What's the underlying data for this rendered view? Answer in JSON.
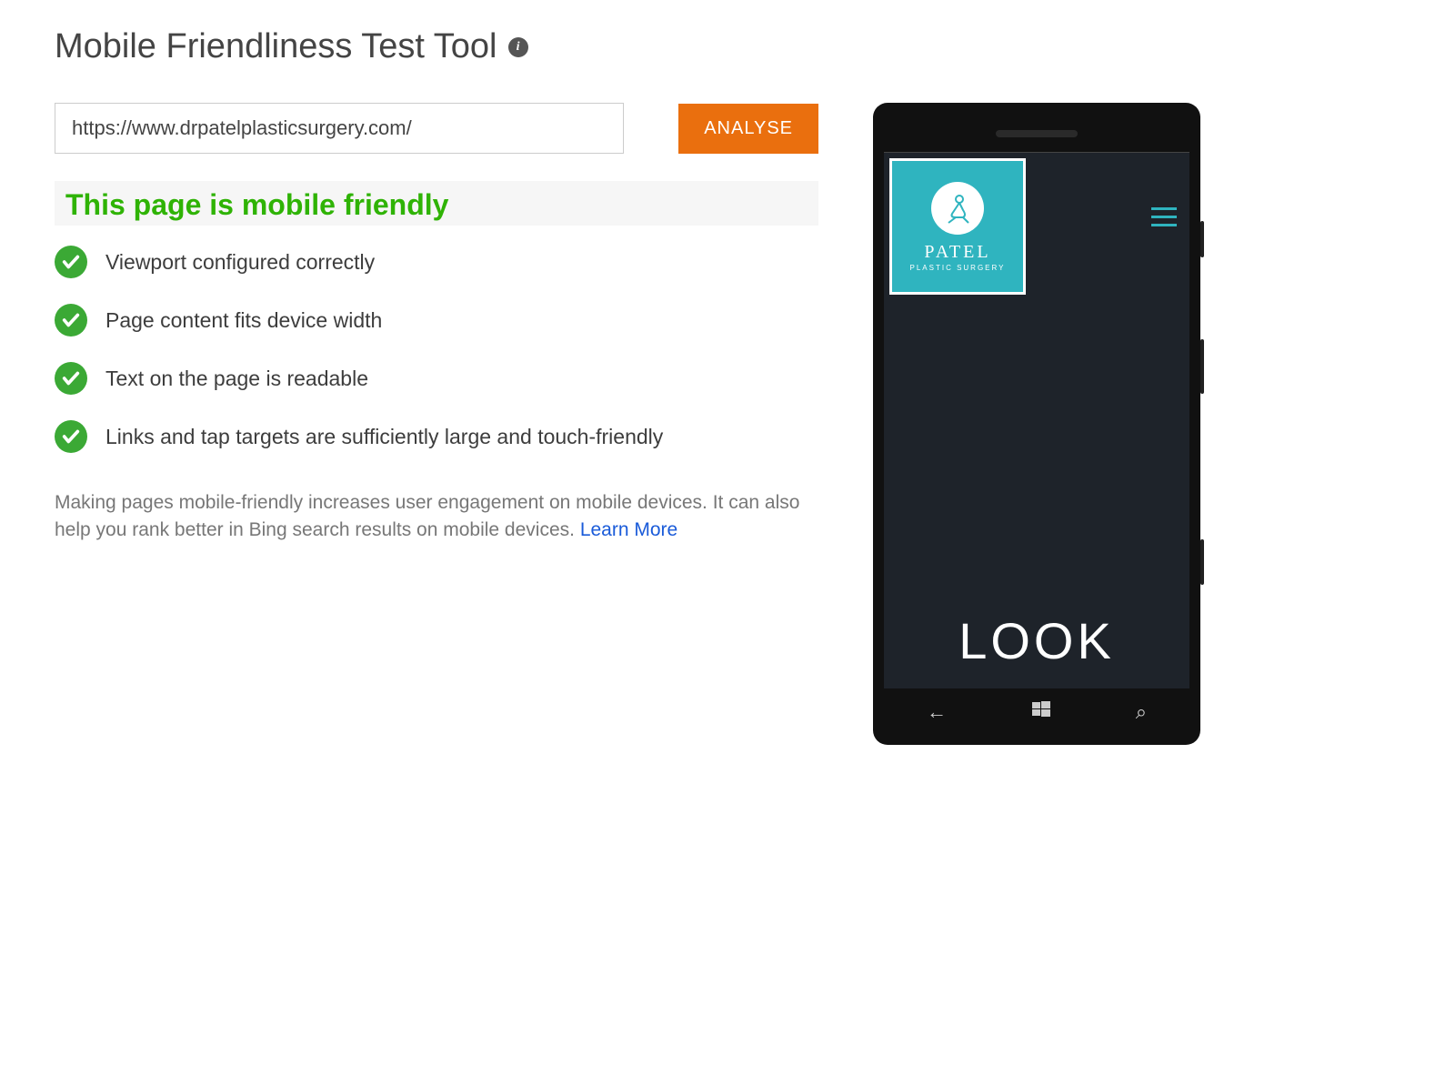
{
  "header": {
    "title": "Mobile Friendliness Test Tool"
  },
  "form": {
    "url_value": "https://www.drpatelplasticsurgery.com/",
    "analyse_label": "ANALYSE"
  },
  "result": {
    "heading": "This page is mobile friendly",
    "checks": [
      "Viewport configured correctly",
      "Page content fits device width",
      "Text on the page is readable",
      "Links and tap targets are sufficiently large and touch-friendly"
    ]
  },
  "footer": {
    "text": "Making pages mobile-friendly increases user engagement on mobile devices. It can also help you rank better in Bing search results on mobile devices. ",
    "learn_more_label": "Learn More"
  },
  "preview": {
    "brand_name": "PATEL",
    "brand_sub": "PLASTIC SURGERY",
    "hero_text": "LOOK",
    "nav_back_glyph": "←",
    "nav_search_glyph": "⌕"
  },
  "colors": {
    "success": "#3ba935",
    "success_text": "#2fb305",
    "accent": "#ea6f0e",
    "brand_teal": "#2fb4bf",
    "link": "#1a5bd9"
  }
}
